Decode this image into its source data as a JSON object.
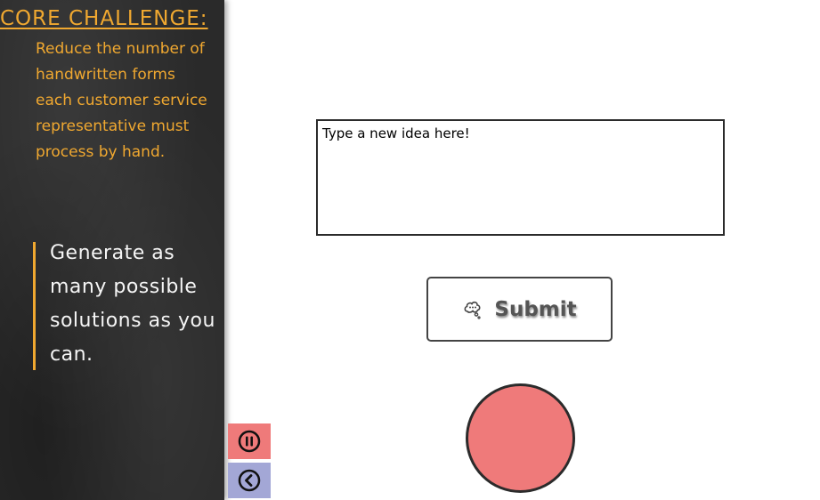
{
  "sidebar": {
    "challenge_title": "CORE CHALLENGE:",
    "challenge_text": "Reduce the number of handwritten forms each customer service representative must process by hand.",
    "prompt": "Generate as many possible solutions as you can."
  },
  "controls": {
    "pause_icon": "pause-icon",
    "back_icon": "back-arrow-icon",
    "pause_color": "#ef7a7a",
    "back_color": "#a3a7d6"
  },
  "idea": {
    "placeholder": "Type a new idea here!"
  },
  "submit": {
    "label": "Submit",
    "icon": "thought-bubble-icon"
  },
  "status": {
    "color": "#ef7a7a"
  }
}
